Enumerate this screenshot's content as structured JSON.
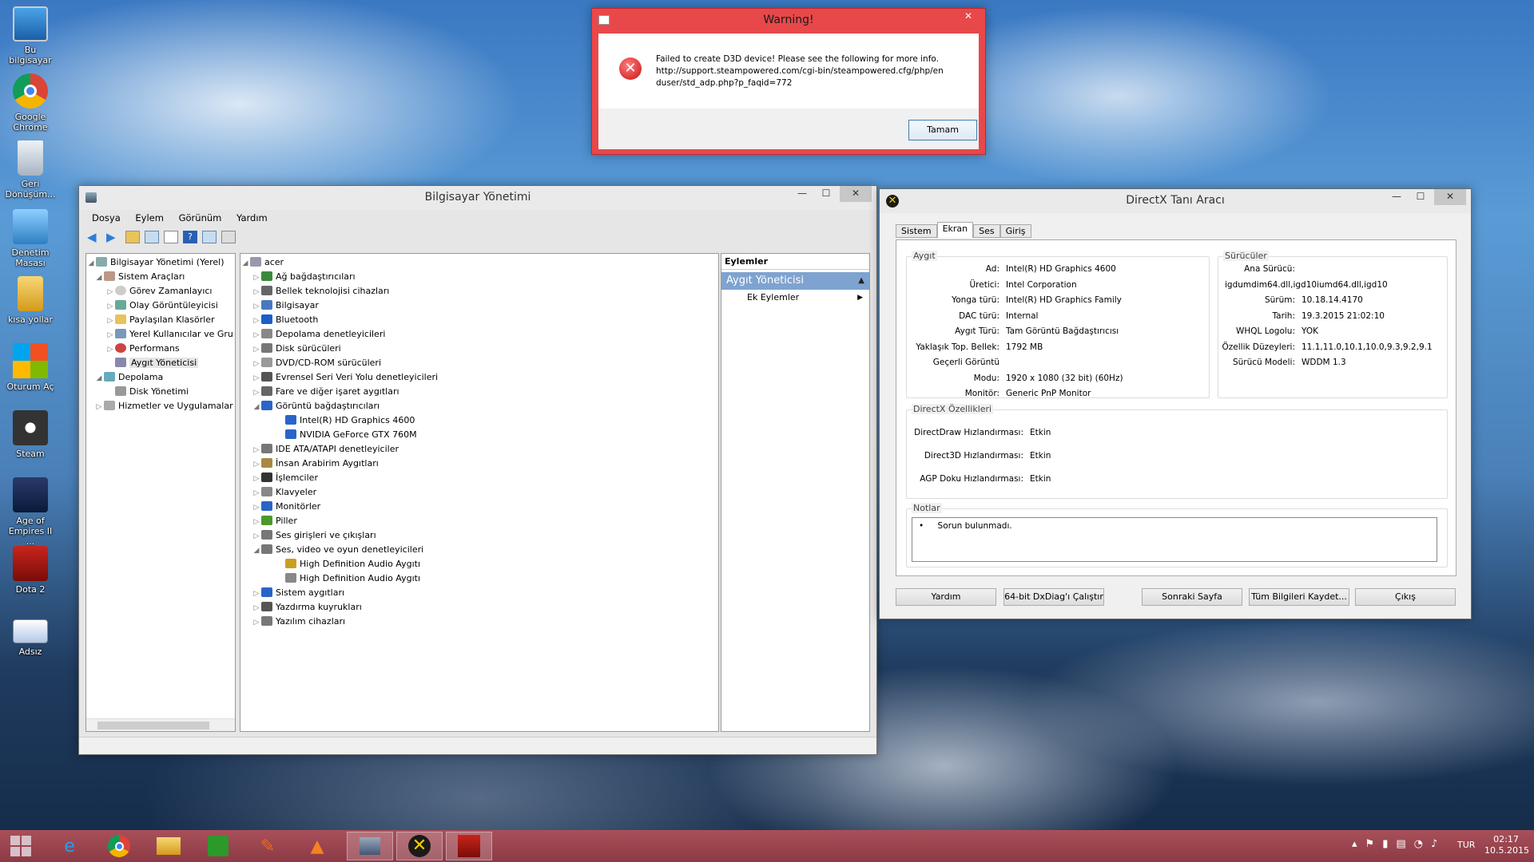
{
  "desktop": {
    "icons": [
      "Bu bilgisayar",
      "Google Chrome",
      "Geri Dönüşüm...",
      "Denetim Masası",
      "kısa yollar",
      "Oturum Aç",
      "Steam",
      "Age of Empires II ...",
      "Dota 2",
      "Adsız"
    ]
  },
  "warning": {
    "title": "Warning!",
    "message": "Failed to create D3D device! Please see the following for more info.",
    "link1": "http://support.steampowered.com/cgi-bin/steampowered.cfg/php/en",
    "link2": "duser/std_adp.php?p_faqid=772",
    "ok": "Tamam",
    "close": "✕"
  },
  "mgmt": {
    "title": "Bilgisayar Yönetimi",
    "minimize": "—",
    "maximize": "☐",
    "close": "✕",
    "menu": [
      "Dosya",
      "Eylem",
      "Görünüm",
      "Yardım"
    ],
    "left_tree": [
      "Bilgisayar Yönetimi (Yerel)",
      "Sistem Araçları",
      "Görev Zamanlayıcı",
      "Olay Görüntüleyicisi",
      "Paylaşılan Klasörler",
      "Yerel Kullanıcılar ve Gru",
      "Performans",
      "Aygıt Yöneticisi",
      "Depolama",
      "Disk Yönetimi",
      "Hizmetler ve Uygulamalar"
    ],
    "root": "acer",
    "devices": [
      "Ağ bağdaştırıcıları",
      "Bellek teknolojisi cihazları",
      "Bilgisayar",
      "Bluetooth",
      "Depolama denetleyicileri",
      "Disk sürücüleri",
      "DVD/CD-ROM sürücüleri",
      "Evrensel Seri Veri Yolu denetleyicileri",
      "Fare ve diğer işaret aygıtları",
      "Görüntü bağdaştırıcıları",
      "Intel(R) HD Graphics 4600",
      "NVIDIA GeForce GTX 760M",
      "IDE ATA/ATAPI denetleyiciler",
      "İnsan Arabirim Aygıtları",
      "İşlemciler",
      "Klavyeler",
      "Monitörler",
      "Piller",
      "Ses girişleri ve çıkışları",
      "Ses, video ve oyun denetleyicileri",
      "High Definition Audio Aygıtı",
      "High Definition Audio Aygıtı",
      "Sistem aygıtları",
      "Yazdırma kuyrukları",
      "Yazılım cihazları"
    ],
    "actions_header": "Eylemler",
    "actions_section": "Aygıt Yöneticisi",
    "actions_more": "Ek Eylemler"
  },
  "dx": {
    "title": "DirectX Tanı Aracı",
    "minimize": "—",
    "maximize": "☐",
    "close": "✕",
    "tabs": [
      "Sistem",
      "Ekran",
      "Ses",
      "Giriş"
    ],
    "device_caption": "Aygıt",
    "drivers_caption": "Sürücüler",
    "device": [
      [
        "Ad:",
        "Intel(R) HD Graphics 4600"
      ],
      [
        "Üretici:",
        "Intel Corporation"
      ],
      [
        "Yonga türü:",
        "Intel(R) HD Graphics Family"
      ],
      [
        "DAC türü:",
        "Internal"
      ],
      [
        "Aygıt Türü:",
        "Tam Görüntü Bağdaştırıcısı"
      ],
      [
        "Yaklaşık Top. Bellek:",
        "1792 MB"
      ],
      [
        "Geçerli Görüntü Modu:",
        "1920 x 1080 (32 bit) (60Hz)"
      ],
      [
        "Monitör:",
        "Generic PnP Monitor"
      ]
    ],
    "drivers": [
      [
        "Ana Sürücü:",
        "igdumdim64.dll,igd10iumd64.dll,igd10"
      ],
      [
        "Sürüm:",
        "10.18.14.4170"
      ],
      [
        "Tarih:",
        "19.3.2015 21:02:10"
      ],
      [
        "WHQL Logolu:",
        "YOK"
      ],
      [
        "Özellik Düzeyleri:",
        "11.1,11.0,10.1,10.0,9.3,9.2,9.1"
      ],
      [
        "Sürücü Modeli:",
        "WDDM 1.3"
      ]
    ],
    "features_caption": "DirectX Özellikleri",
    "features": [
      [
        "DirectDraw Hızlandırması:",
        "Etkin"
      ],
      [
        "Direct3D Hızlandırması:",
        "Etkin"
      ],
      [
        "AGP Doku Hızlandırması:",
        "Etkin"
      ]
    ],
    "notes_caption": "Notlar",
    "notes": "Sorun bulunmadı.",
    "buttons": [
      "Yardım",
      "64-bit DxDiag'ı Çalıştır",
      "Sonraki Sayfa",
      "Tüm Bilgileri Kaydet...",
      "Çıkış"
    ]
  },
  "taskbar": {
    "lang": "TUR",
    "time": "02:17",
    "date": "10.5.2015"
  }
}
